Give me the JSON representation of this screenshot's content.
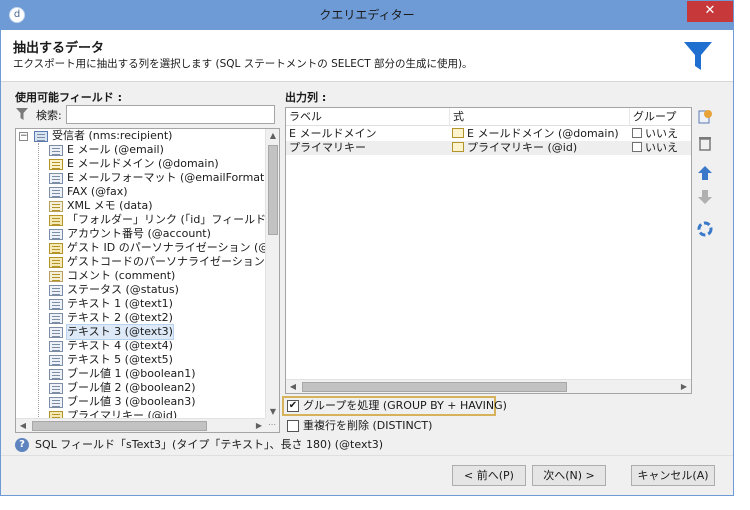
{
  "window": {
    "title": "クエリエディター",
    "app_icon": "d",
    "close_glyph": "✕"
  },
  "header": {
    "title": "抽出するデータ",
    "description": "エクスポート用に抽出する列を選択します (SQL ステートメントの SELECT 部分の生成に使用)。"
  },
  "left": {
    "section_label": "使用可能フィールド :",
    "search_label": "検索:",
    "search_value": "",
    "tree": [
      {
        "label": "受信者 (nms:recipient)",
        "type": "entity",
        "level": 0,
        "expand": "−"
      },
      {
        "label": "E メール (@email)",
        "type": "field",
        "level": 1
      },
      {
        "label": "E メールドメイン (@domain)",
        "type": "sel",
        "level": 1
      },
      {
        "label": "E メールフォーマット (@emailFormat)",
        "type": "field",
        "level": 1
      },
      {
        "label": "FAX (@fax)",
        "type": "field",
        "level": 1
      },
      {
        "label": "XML メモ (data)",
        "type": "link",
        "level": 1
      },
      {
        "label": "「フォルダー」リンク (「id」フィールド) の外部キー (",
        "type": "key",
        "level": 1
      },
      {
        "label": "アカウント番号 (@account)",
        "type": "field",
        "level": 1
      },
      {
        "label": "ゲスト ID のパーソナライゼーション (@guestIdE",
        "type": "key",
        "level": 1
      },
      {
        "label": "ゲストコードのパーソナライゼーション (@guestCo",
        "type": "key",
        "level": 1
      },
      {
        "label": "コメント (comment)",
        "type": "link",
        "level": 1
      },
      {
        "label": "ステータス (@status)",
        "type": "field",
        "level": 1
      },
      {
        "label": "テキスト 1 (@text1)",
        "type": "field",
        "level": 1
      },
      {
        "label": "テキスト 2 (@text2)",
        "type": "field",
        "level": 1
      },
      {
        "label": "テキスト 3 (@text3)",
        "type": "field",
        "level": 1,
        "highlight": true
      },
      {
        "label": "テキスト 4 (@text4)",
        "type": "field",
        "level": 1
      },
      {
        "label": "テキスト 5 (@text5)",
        "type": "field",
        "level": 1
      },
      {
        "label": "ブール値 1 (@boolean1)",
        "type": "field",
        "level": 1
      },
      {
        "label": "ブール値 2 (@boolean2)",
        "type": "field",
        "level": 1
      },
      {
        "label": "ブール値 3 (@boolean3)",
        "type": "field",
        "level": 1
      },
      {
        "label": "プライマリキー (@id)",
        "type": "key",
        "level": 1
      }
    ]
  },
  "right": {
    "section_label": "出力列 :",
    "columns": [
      "ラベル",
      "式",
      "グループ"
    ],
    "rows": [
      {
        "label": "E メールドメイン",
        "expression": "E メールドメイン (@domain)",
        "group": "いいえ"
      },
      {
        "label": "プライマリキー",
        "expression": "プライマリキー (@id)",
        "group": "いいえ"
      }
    ],
    "tools": [
      "add-icon",
      "delete-icon",
      "move-up-icon",
      "move-down-icon",
      "distribution-icon"
    ]
  },
  "options": {
    "group_by": {
      "label": "グループを処理 (GROUP BY + HAVING)",
      "checked": true,
      "check_glyph": "✔"
    },
    "distinct": {
      "label": "重複行を削除 (DISTINCT)",
      "checked": false
    }
  },
  "status": {
    "icon_glyph": "?",
    "text": "SQL フィールド「sText3」(タイプ「テキスト」、長さ 180) (@text3)"
  },
  "buttons": {
    "prev": "< 前へ(P)",
    "next": "次へ(N) >",
    "cancel": "キャンセル(A)"
  },
  "colors": {
    "titlebar": "#6e9bd6",
    "close": "#c7383a",
    "focus_border": "#d6b25a",
    "funnel": "#1f6fd1"
  }
}
